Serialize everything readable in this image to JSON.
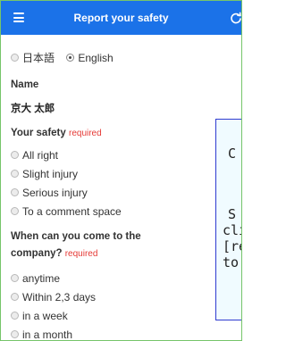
{
  "header": {
    "title": "Report your safety"
  },
  "language": {
    "options": [
      {
        "label": "日本語",
        "checked": false
      },
      {
        "label": "English",
        "checked": true
      }
    ]
  },
  "name_section": {
    "label": "Name",
    "value": "京大 太郎"
  },
  "safety_section": {
    "label": "Your safety",
    "required": "required",
    "options": [
      "All right",
      "Slight injury",
      "Serious injury",
      "To a comment space"
    ]
  },
  "company_section": {
    "label_line1": "When can you come to the",
    "label_line2": "company?",
    "required": "required",
    "options": [
      "anytime",
      "Within 2,3 days",
      "in a week",
      "in a month"
    ]
  },
  "popup": {
    "lines": [
      "C",
      "S",
      "clic",
      "[re",
      "to"
    ]
  }
}
